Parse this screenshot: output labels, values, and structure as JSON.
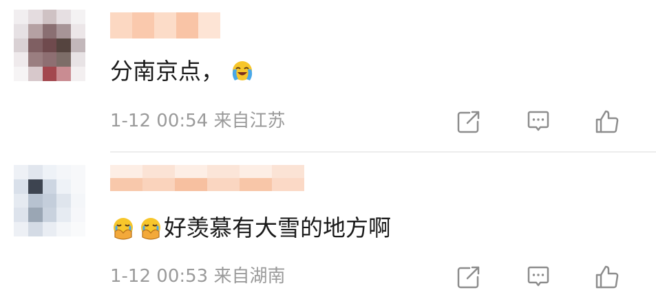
{
  "comments": [
    {
      "username": "",
      "text": "分南京点，",
      "leading_emojis": [],
      "trailing_emojis": [
        "tears-of-joy-emoji"
      ],
      "time": "1-12 00:54",
      "location": "来自江苏",
      "actions": {
        "share": "share-icon",
        "reply": "comment-icon",
        "like": "thumbs-up-icon"
      }
    },
    {
      "username": "",
      "text": "好羡慕有大雪的地方啊",
      "leading_emojis": [
        "crying-hands-emoji",
        "crying-hands-emoji"
      ],
      "trailing_emojis": [],
      "time": "1-12 00:53",
      "location": "来自湖南",
      "actions": {
        "share": "share-icon",
        "reply": "comment-icon",
        "like": "thumbs-up-icon"
      }
    }
  ],
  "colors": {
    "text": "#1a1a1a",
    "meta": "#9a9a9a",
    "icon": "#8c8c8c",
    "divider": "#ececec",
    "username_blur": "#f7c9ad"
  }
}
